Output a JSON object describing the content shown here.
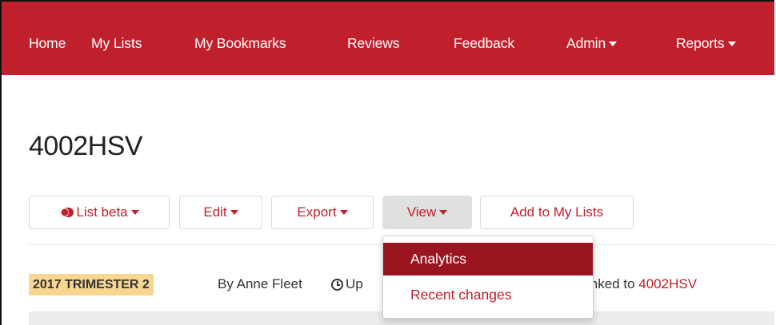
{
  "navbar": {
    "items": [
      {
        "label": "Home"
      },
      {
        "label": "My Lists"
      },
      {
        "label": "My Bookmarks"
      },
      {
        "label": "Reviews"
      },
      {
        "label": "Feedback"
      },
      {
        "label": "Admin",
        "dropdown": true
      },
      {
        "label": "Reports",
        "dropdown": true
      }
    ]
  },
  "page": {
    "title": "4002HSV"
  },
  "toolbar": {
    "list_beta_label": "List beta",
    "edit_label": "Edit",
    "export_label": "Export",
    "view_label": "View",
    "add_to_my_lists_label": "Add to My Lists"
  },
  "view_menu": {
    "items": [
      {
        "label": "Analytics",
        "highlighted": true
      },
      {
        "label": "Recent changes",
        "highlighted": false
      }
    ]
  },
  "meta": {
    "badge": "2017 TRIMESTER 2",
    "author": "By Anne Fleet",
    "updated_partial": "Up",
    "linked_prefix": "inked to ",
    "linked_code": "4002HSV"
  },
  "colors": {
    "brand": "#c0202c",
    "menu_highlight": "#9b1521",
    "badge_bg": "#f7d690"
  },
  "icons": [
    "toggle-icon",
    "caret-down-icon",
    "clock-icon"
  ]
}
